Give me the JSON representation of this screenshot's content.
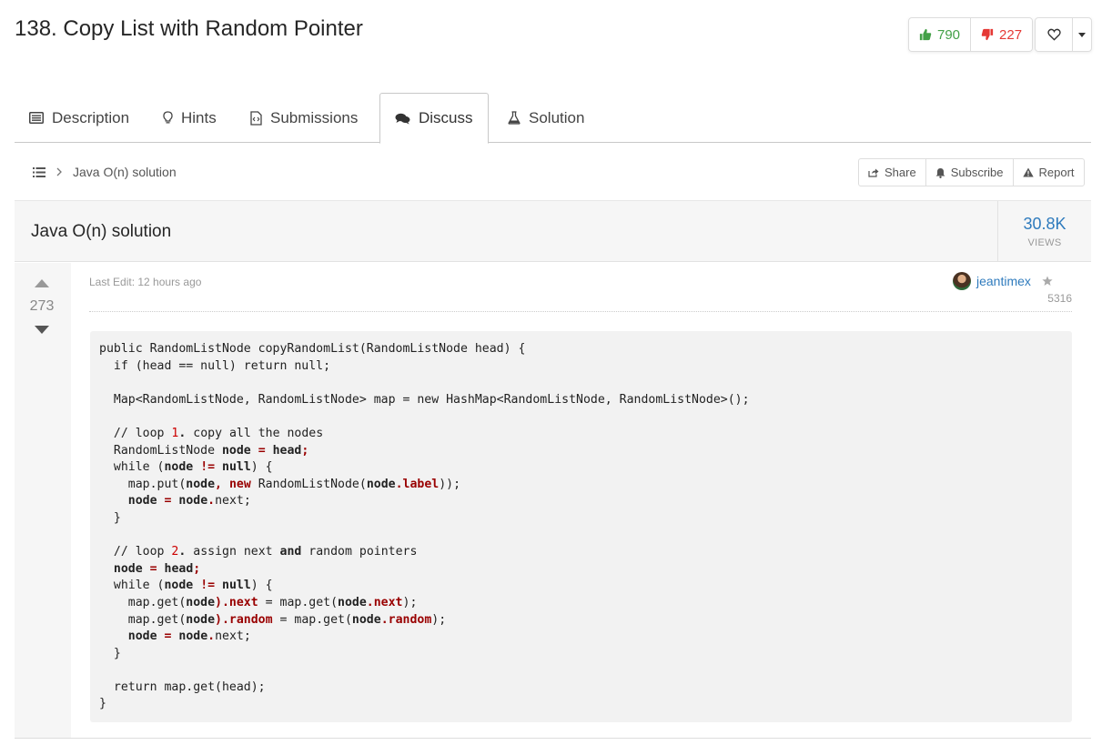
{
  "problem": {
    "title": "138. Copy List with Random Pointer"
  },
  "votes": {
    "up": "790",
    "down": "227"
  },
  "tabs": [
    {
      "label": "Description",
      "icon": "list-alt-icon"
    },
    {
      "label": "Hints",
      "icon": "lightbulb-icon"
    },
    {
      "label": "Submissions",
      "icon": "file-code-icon"
    },
    {
      "label": "Discuss",
      "icon": "comments-icon",
      "active": true
    },
    {
      "label": "Solution",
      "icon": "flask-icon"
    }
  ],
  "breadcrumb": {
    "current": "Java O(n) solution"
  },
  "actions": {
    "share": "Share",
    "subscribe": "Subscribe",
    "report": "Report"
  },
  "topic": {
    "title": "Java O(n) solution",
    "views_count": "30.8K",
    "views_label": "VIEWS"
  },
  "post": {
    "score": "273",
    "last_edit": "Last Edit: 12 hours ago",
    "author": "jeantimex",
    "reputation": "5316"
  },
  "code": {
    "lines": [
      "public RandomListNode copyRandomList(RandomListNode head) {",
      "  if (head == null) return null;",
      "",
      "  Map<RandomListNode, RandomListNode> map = new HashMap<RandomListNode, RandomListNode>();",
      "",
      "  // loop 1. copy all the nodes",
      "  RandomListNode node = head;",
      "  while (node != null) {",
      "    map.put(node, new RandomListNode(node.label));",
      "    node = node.next;",
      "  }",
      "",
      "  // loop 2. assign next and random pointers",
      "  node = head;",
      "  while (node != null) {",
      "    map.get(node).next = map.get(node.next);",
      "    map.get(node).random = map.get(node.random);",
      "    node = node.next;",
      "  }",
      "",
      "  return map.get(head);",
      "}"
    ]
  },
  "colors": {
    "link": "#2f7bbd",
    "upvote": "#43a047",
    "downvote": "#e53935",
    "code_red": "#990000"
  }
}
